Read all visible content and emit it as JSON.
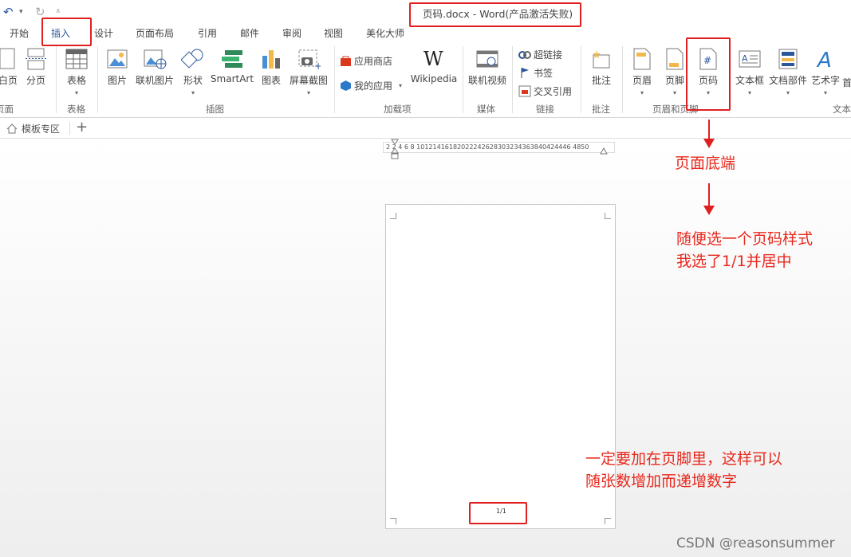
{
  "titlebar": {
    "title": "页码.docx - Word(产品激活失败)",
    "undo_glyph": "↶",
    "redo_glyph": "↻",
    "dropdown_glyph": "▾",
    "custom_glyph": "⩡"
  },
  "tabs": [
    "开始",
    "插入",
    "设计",
    "页面布局",
    "引用",
    "邮件",
    "审阅",
    "视图",
    "美化大师"
  ],
  "ribbon": {
    "buttons": {
      "blank_page": "白页",
      "page_break": "分页",
      "table": "表格",
      "picture": "图片",
      "online_picture": "联机图片",
      "shapes": "形状",
      "smartart": "SmartArt",
      "chart": "图表",
      "screenshot": "屏幕截图",
      "wikipedia": "Wikipedia",
      "online_video": "联机视频",
      "comment": "批注",
      "header": "页眉",
      "footer": "页脚",
      "page_number": "页码",
      "textbox": "文本框",
      "quick_parts": "文档部件",
      "wordart": "艺术字",
      "first": "首"
    },
    "small": {
      "app_store": "应用商店",
      "my_apps": "我的应用",
      "hyperlink": "超链接",
      "bookmark": "书签",
      "cross_ref": "交叉引用"
    },
    "groups": {
      "pages": "页面",
      "tables": "表格",
      "illustrations": "插图",
      "addins": "加载项",
      "media": "媒体",
      "links": "链接",
      "comments": "批注",
      "header_footer": "页眉和页脚",
      "text": "文本"
    }
  },
  "template_bar": {
    "tab": "模板专区",
    "add": "+"
  },
  "ruler": {
    "text": "2   2  4  6  8 10121416182022242628303234363840424446 4850"
  },
  "page": {
    "number_text": "1/1"
  },
  "annotations": {
    "a1": "页面底端",
    "a2_line1": "随便选一个页码样式",
    "a2_line2": "我选了1/1并居中",
    "a3_line1": "一定要加在页脚里，这样可以",
    "a3_line2": "随张数增加而递增数字"
  },
  "watermark": "CSDN @reasonsummer",
  "colors": {
    "accent": "#2b579a",
    "annotation": "#e8281d"
  }
}
